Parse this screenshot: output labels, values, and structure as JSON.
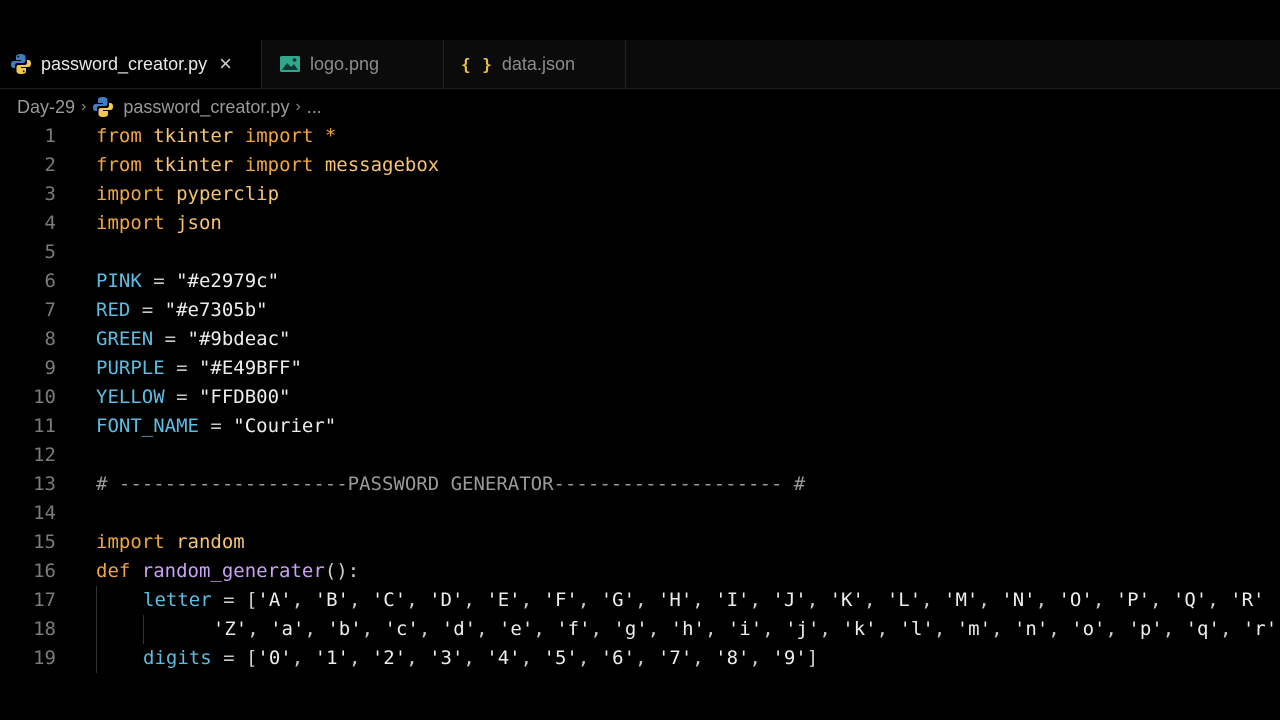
{
  "tabs": [
    {
      "label": "password_creator.py",
      "icon": "python-icon",
      "active": true
    },
    {
      "label": "logo.png",
      "icon": "image-icon",
      "active": false
    },
    {
      "label": "data.json",
      "icon": "json-braces-icon",
      "active": false
    }
  ],
  "tab_close": "×",
  "json_icon_glyph": "{ }",
  "breadcrumb": {
    "folder": "Day-29",
    "file": "password_creator.py",
    "more": "...",
    "separator": "›"
  },
  "code_lines": [
    {
      "n": "1",
      "tokens": [
        [
          "kw",
          "from"
        ],
        [
          "",
          " "
        ],
        [
          "mod",
          "tkinter"
        ],
        [
          "",
          " "
        ],
        [
          "kw",
          "import"
        ],
        [
          "",
          " "
        ],
        [
          "kw",
          "*"
        ]
      ]
    },
    {
      "n": "2",
      "tokens": [
        [
          "kw",
          "from"
        ],
        [
          "",
          " "
        ],
        [
          "mod",
          "tkinter"
        ],
        [
          "",
          " "
        ],
        [
          "kw",
          "import"
        ],
        [
          "",
          " "
        ],
        [
          "mod",
          "messagebox"
        ]
      ]
    },
    {
      "n": "3",
      "tokens": [
        [
          "kw",
          "import"
        ],
        [
          "",
          " "
        ],
        [
          "mod",
          "pyperclip"
        ]
      ]
    },
    {
      "n": "4",
      "tokens": [
        [
          "kw",
          "import"
        ],
        [
          "",
          " "
        ],
        [
          "mod",
          "json"
        ]
      ]
    },
    {
      "n": "5",
      "tokens": []
    },
    {
      "n": "6",
      "tokens": [
        [
          "var",
          "PINK"
        ],
        [
          "op",
          " = "
        ],
        [
          "str",
          "\"#e2979c\""
        ]
      ]
    },
    {
      "n": "7",
      "tokens": [
        [
          "var",
          "RED"
        ],
        [
          "op",
          " = "
        ],
        [
          "str",
          "\"#e7305b\""
        ]
      ]
    },
    {
      "n": "8",
      "tokens": [
        [
          "var",
          "GREEN"
        ],
        [
          "op",
          " = "
        ],
        [
          "str",
          "\"#9bdeac\""
        ]
      ]
    },
    {
      "n": "9",
      "tokens": [
        [
          "var",
          "PURPLE"
        ],
        [
          "op",
          " = "
        ],
        [
          "str",
          "\"#E49BFF\""
        ]
      ]
    },
    {
      "n": "10",
      "tokens": [
        [
          "var",
          "YELLOW"
        ],
        [
          "op",
          " = "
        ],
        [
          "str",
          "\"FFDB00\""
        ]
      ]
    },
    {
      "n": "11",
      "tokens": [
        [
          "var",
          "FONT_NAME"
        ],
        [
          "op",
          " = "
        ],
        [
          "str",
          "\"Courier\""
        ]
      ]
    },
    {
      "n": "12",
      "tokens": []
    },
    {
      "n": "13",
      "tokens": [
        [
          "cmt",
          "# --------------------PASSWORD GENERATOR-------------------- #"
        ]
      ]
    },
    {
      "n": "14",
      "tokens": []
    },
    {
      "n": "15",
      "tokens": [
        [
          "kw",
          "import"
        ],
        [
          "",
          " "
        ],
        [
          "mod",
          "random"
        ]
      ]
    },
    {
      "n": "16",
      "tokens": [
        [
          "kw",
          "def"
        ],
        [
          "",
          " "
        ],
        [
          "fn",
          "random_generater"
        ],
        [
          "pn",
          "():"
        ]
      ]
    },
    {
      "n": "17",
      "indent": 1,
      "tokens": [
        [
          "var",
          "letter"
        ],
        [
          "op",
          " = "
        ],
        [
          "pn",
          "["
        ],
        [
          "str",
          "'A'"
        ],
        [
          "pn",
          ", "
        ],
        [
          "str",
          "'B'"
        ],
        [
          "pn",
          ", "
        ],
        [
          "str",
          "'C'"
        ],
        [
          "pn",
          ", "
        ],
        [
          "str",
          "'D'"
        ],
        [
          "pn",
          ", "
        ],
        [
          "str",
          "'E'"
        ],
        [
          "pn",
          ", "
        ],
        [
          "str",
          "'F'"
        ],
        [
          "pn",
          ", "
        ],
        [
          "str",
          "'G'"
        ],
        [
          "pn",
          ", "
        ],
        [
          "str",
          "'H'"
        ],
        [
          "pn",
          ", "
        ],
        [
          "str",
          "'I'"
        ],
        [
          "pn",
          ", "
        ],
        [
          "str",
          "'J'"
        ],
        [
          "pn",
          ", "
        ],
        [
          "str",
          "'K'"
        ],
        [
          "pn",
          ", "
        ],
        [
          "str",
          "'L'"
        ],
        [
          "pn",
          ", "
        ],
        [
          "str",
          "'M'"
        ],
        [
          "pn",
          ", "
        ],
        [
          "str",
          "'N'"
        ],
        [
          "pn",
          ", "
        ],
        [
          "str",
          "'O'"
        ],
        [
          "pn",
          ", "
        ],
        [
          "str",
          "'P'"
        ],
        [
          "pn",
          ", "
        ],
        [
          "str",
          "'Q'"
        ],
        [
          "pn",
          ", "
        ],
        [
          "str",
          "'R'"
        ]
      ]
    },
    {
      "n": "18",
      "indent": 2,
      "tokens": [
        [
          "",
          "  "
        ],
        [
          "str",
          "'Z'"
        ],
        [
          "pn",
          ", "
        ],
        [
          "str",
          "'a'"
        ],
        [
          "pn",
          ", "
        ],
        [
          "str",
          "'b'"
        ],
        [
          "pn",
          ", "
        ],
        [
          "str",
          "'c'"
        ],
        [
          "pn",
          ", "
        ],
        [
          "str",
          "'d'"
        ],
        [
          "pn",
          ", "
        ],
        [
          "str",
          "'e'"
        ],
        [
          "pn",
          ", "
        ],
        [
          "str",
          "'f'"
        ],
        [
          "pn",
          ", "
        ],
        [
          "str",
          "'g'"
        ],
        [
          "pn",
          ", "
        ],
        [
          "str",
          "'h'"
        ],
        [
          "pn",
          ", "
        ],
        [
          "str",
          "'i'"
        ],
        [
          "pn",
          ", "
        ],
        [
          "str",
          "'j'"
        ],
        [
          "pn",
          ", "
        ],
        [
          "str",
          "'k'"
        ],
        [
          "pn",
          ", "
        ],
        [
          "str",
          "'l'"
        ],
        [
          "pn",
          ", "
        ],
        [
          "str",
          "'m'"
        ],
        [
          "pn",
          ", "
        ],
        [
          "str",
          "'n'"
        ],
        [
          "pn",
          ", "
        ],
        [
          "str",
          "'o'"
        ],
        [
          "pn",
          ", "
        ],
        [
          "str",
          "'p'"
        ],
        [
          "pn",
          ", "
        ],
        [
          "str",
          "'q'"
        ],
        [
          "pn",
          ", "
        ],
        [
          "str",
          "'r'"
        ]
      ]
    },
    {
      "n": "19",
      "indent": 1,
      "tokens": [
        [
          "var",
          "digits"
        ],
        [
          "op",
          " = "
        ],
        [
          "pn",
          "["
        ],
        [
          "str",
          "'0'"
        ],
        [
          "pn",
          ", "
        ],
        [
          "str",
          "'1'"
        ],
        [
          "pn",
          ", "
        ],
        [
          "str",
          "'2'"
        ],
        [
          "pn",
          ", "
        ],
        [
          "str",
          "'3'"
        ],
        [
          "pn",
          ", "
        ],
        [
          "str",
          "'4'"
        ],
        [
          "pn",
          ", "
        ],
        [
          "str",
          "'5'"
        ],
        [
          "pn",
          ", "
        ],
        [
          "str",
          "'6'"
        ],
        [
          "pn",
          ", "
        ],
        [
          "str",
          "'7'"
        ],
        [
          "pn",
          ", "
        ],
        [
          "str",
          "'8'"
        ],
        [
          "pn",
          ", "
        ],
        [
          "str",
          "'9'"
        ],
        [
          "pn",
          "]"
        ]
      ]
    }
  ]
}
